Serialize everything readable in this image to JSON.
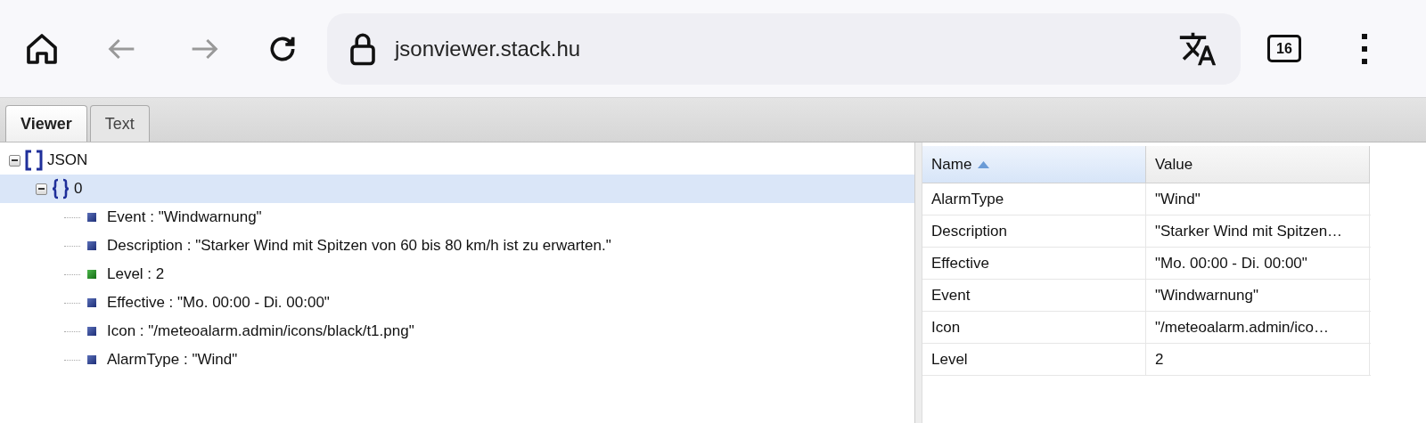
{
  "toolbar": {
    "url": "jsonviewer.stack.hu",
    "tab_count": "16"
  },
  "tabs": [
    {
      "label": "Viewer",
      "selected": true
    },
    {
      "label": "Text",
      "selected": false
    }
  ],
  "tree": [
    {
      "kind": "array",
      "label": "JSON",
      "expanded": true,
      "selected": false,
      "children": [
        {
          "kind": "object",
          "label": "0",
          "expanded": true,
          "selected": true,
          "children": [
            {
              "kind": "string",
              "label": "Event : \"Windwarnung\"",
              "selected": false
            },
            {
              "kind": "string",
              "label": "Description : \"Starker Wind mit Spitzen von 60 bis 80 km/h ist zu erwarten.\"",
              "selected": false
            },
            {
              "kind": "number",
              "label": "Level : 2",
              "selected": false
            },
            {
              "kind": "string",
              "label": "Effective : \"Mo. 00:00 - Di. 00:00\"",
              "selected": false
            },
            {
              "kind": "string",
              "label": "Icon : \"/meteoalarm.admin/icons/black/t1.png\"",
              "selected": false
            },
            {
              "kind": "string",
              "label": "AlarmType : \"Wind\"",
              "selected": false
            }
          ]
        }
      ]
    }
  ],
  "grid": {
    "columns": [
      {
        "label": "Name",
        "sorted": true
      },
      {
        "label": "Value",
        "sorted": false
      }
    ],
    "rows": [
      [
        "AlarmType",
        "\"Wind\""
      ],
      [
        "Description",
        "\"Starker Wind mit Spitzen…"
      ],
      [
        "Effective",
        "\"Mo. 00:00 - Di. 00:00\""
      ],
      [
        "Event",
        "\"Windwarnung\""
      ],
      [
        "Icon",
        "\"/meteoalarm.admin/ico…"
      ],
      [
        "Level",
        "2"
      ]
    ]
  }
}
